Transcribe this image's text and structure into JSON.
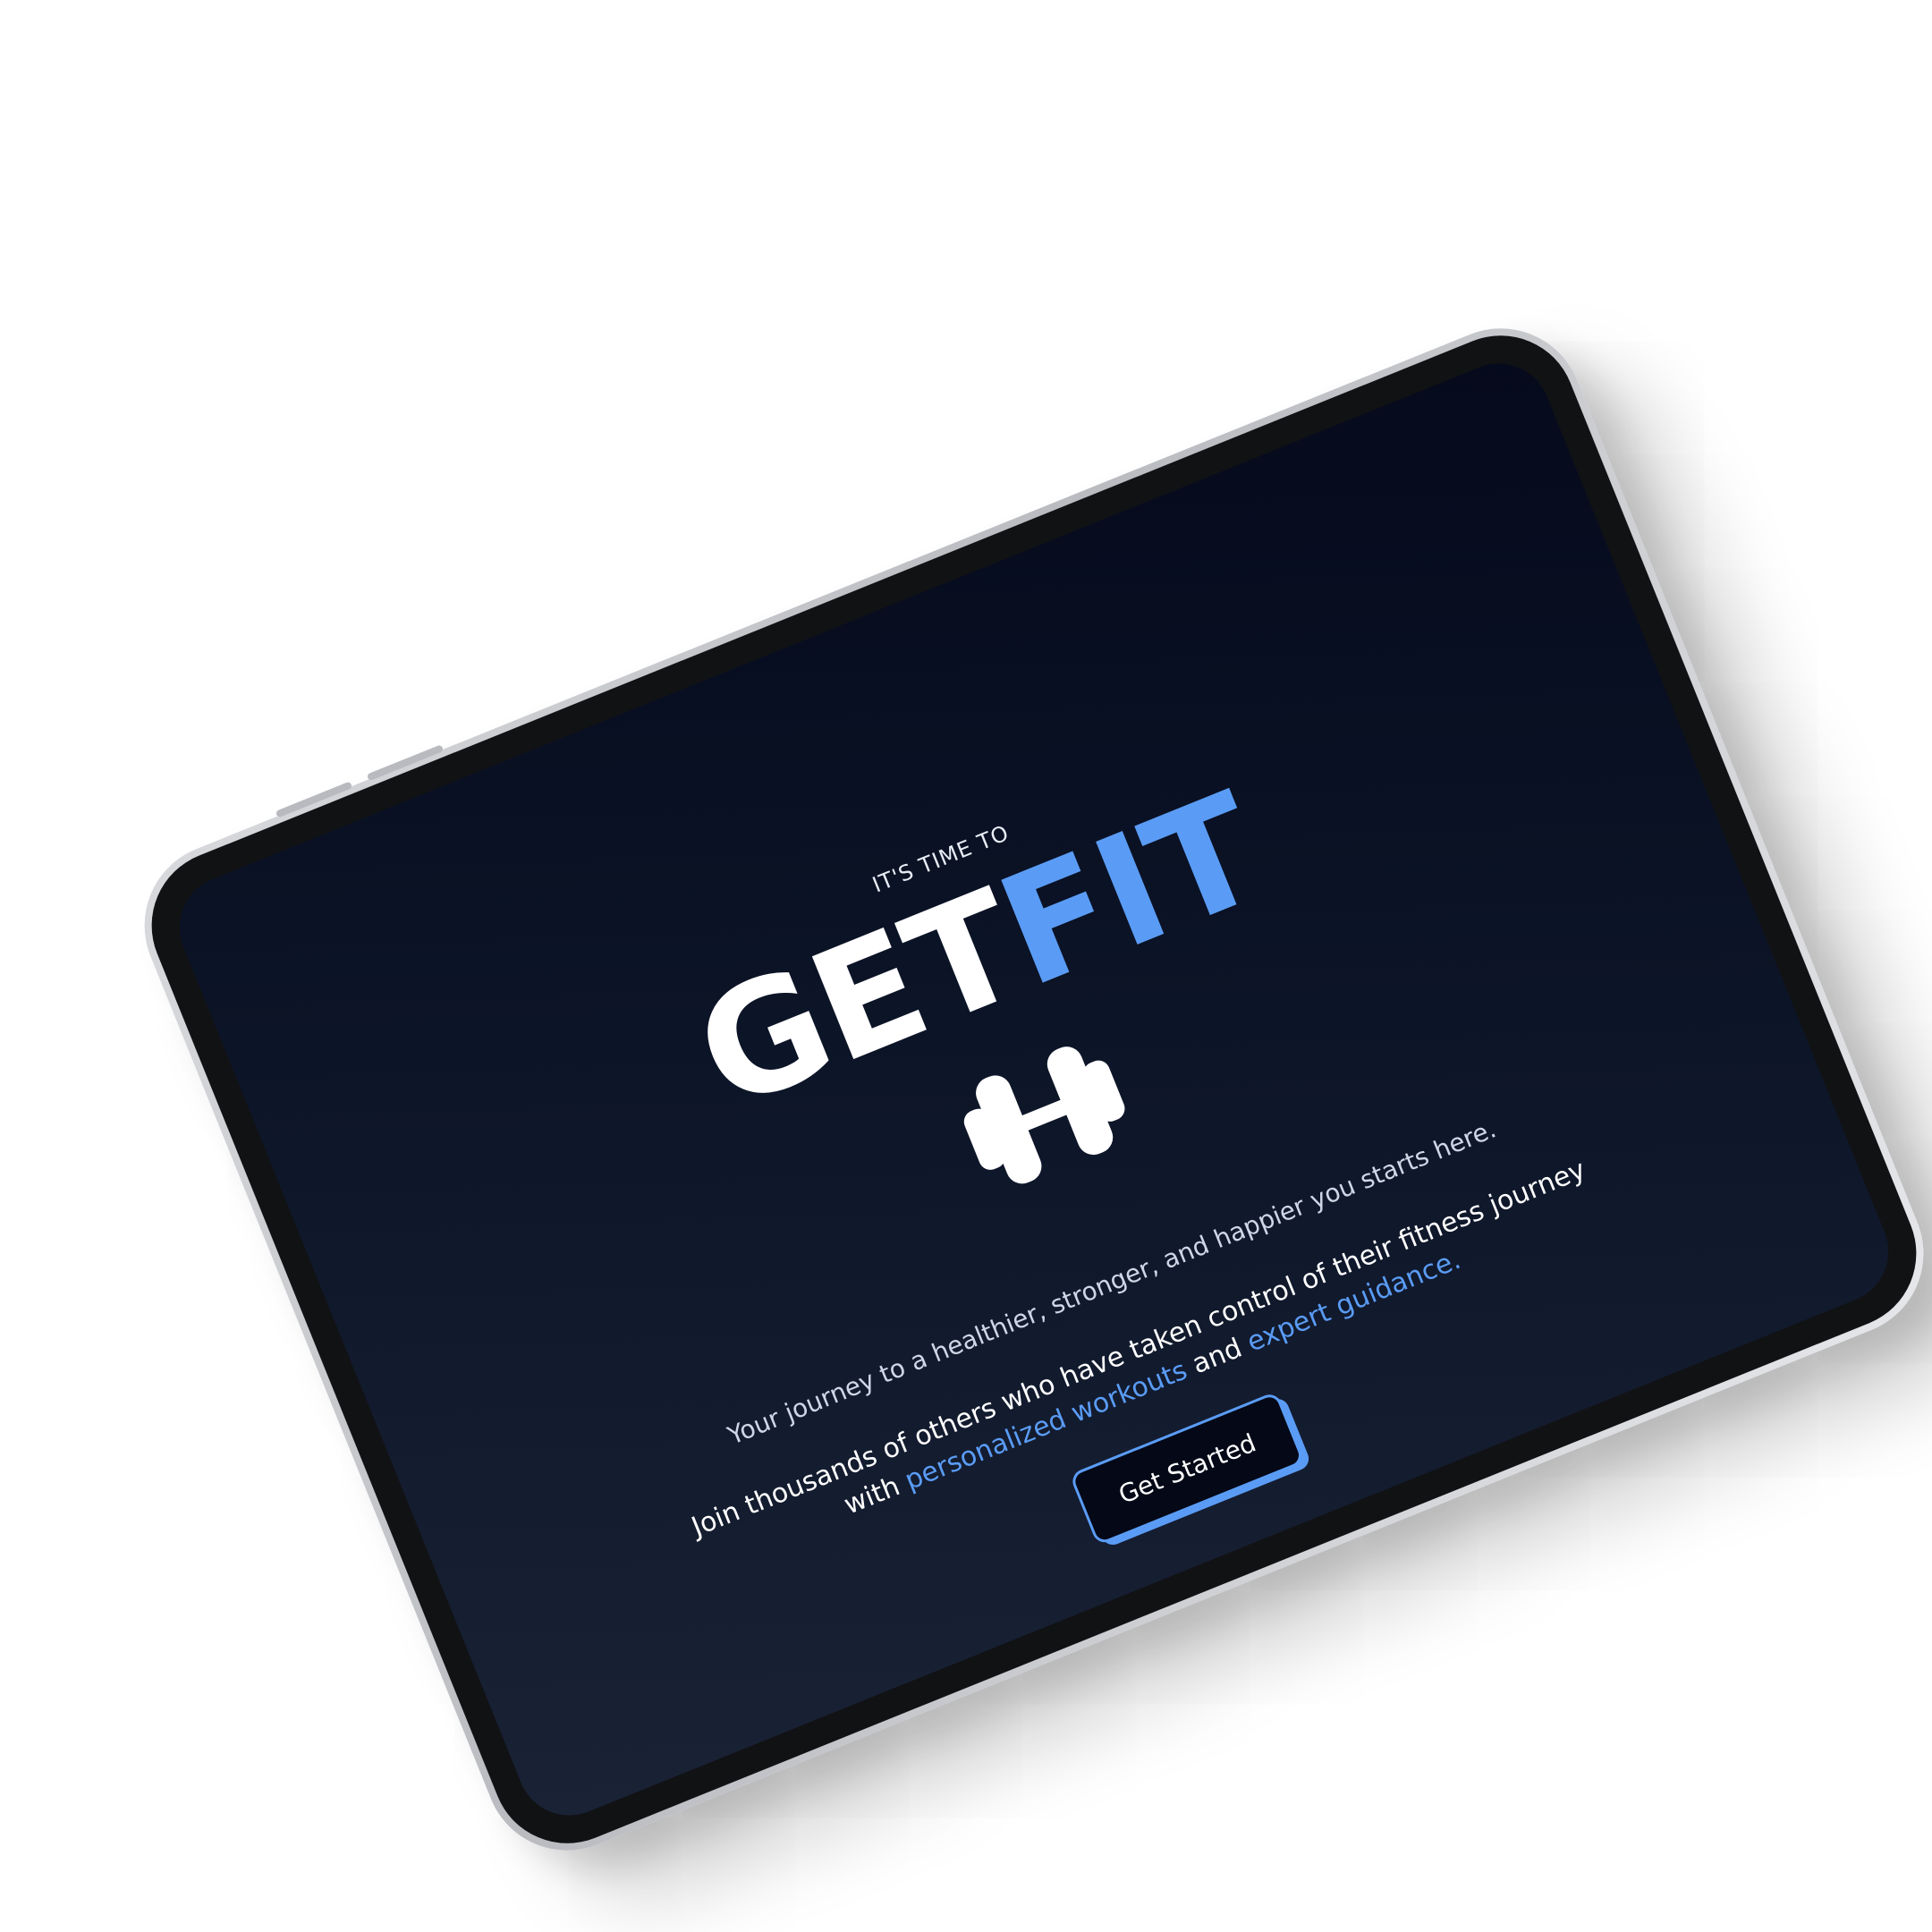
{
  "hero": {
    "eyebrow": "IT'S TIME TO",
    "title_part1": "GET",
    "title_part2": "FIT",
    "tagline": "Your journey to a healthier, stronger, and happier you starts here.",
    "description_prefix": "Join thousands of others who have taken control of their fitness journey with ",
    "description_highlight1": "personalized workouts",
    "description_middle": " and ",
    "description_highlight2": "expert guidance.",
    "cta_label": "Get Started",
    "icon": "dumbbell-icon"
  },
  "colors": {
    "accent": "#5a9cf5",
    "background": "#0c1427",
    "button_bg": "#040817",
    "text": "#ffffff"
  }
}
